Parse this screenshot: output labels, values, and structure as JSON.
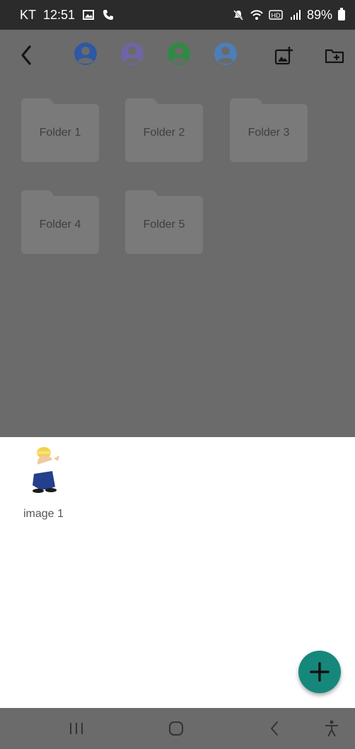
{
  "status_bar": {
    "carrier": "KT",
    "time": "12:51",
    "battery": "89%",
    "icons": [
      "image-icon",
      "phone-icon",
      "mute-icon",
      "wifi-icon",
      "hd-icon",
      "signal-icon",
      "battery-icon"
    ]
  },
  "toolbar": {
    "icons": [
      "back-icon",
      "user-icon",
      "user-icon",
      "user-icon",
      "user-icon",
      "add-image-icon",
      "add-folder-icon"
    ],
    "avatar_colors": [
      "#2e58a6",
      "#7164a6",
      "#2f8a43",
      "#4c7fb9"
    ]
  },
  "folders": [
    {
      "label": "Folder 1"
    },
    {
      "label": "Folder 2"
    },
    {
      "label": "Folder 3"
    },
    {
      "label": "Folder 4"
    },
    {
      "label": "Folder 5"
    }
  ],
  "images": [
    {
      "label": "image 1"
    }
  ],
  "fab": {
    "icon": "plus-icon",
    "color": "#16877b"
  },
  "nav_bar": {
    "icons": [
      "recent-apps-icon",
      "home-icon",
      "back-icon",
      "accessibility-icon"
    ]
  }
}
